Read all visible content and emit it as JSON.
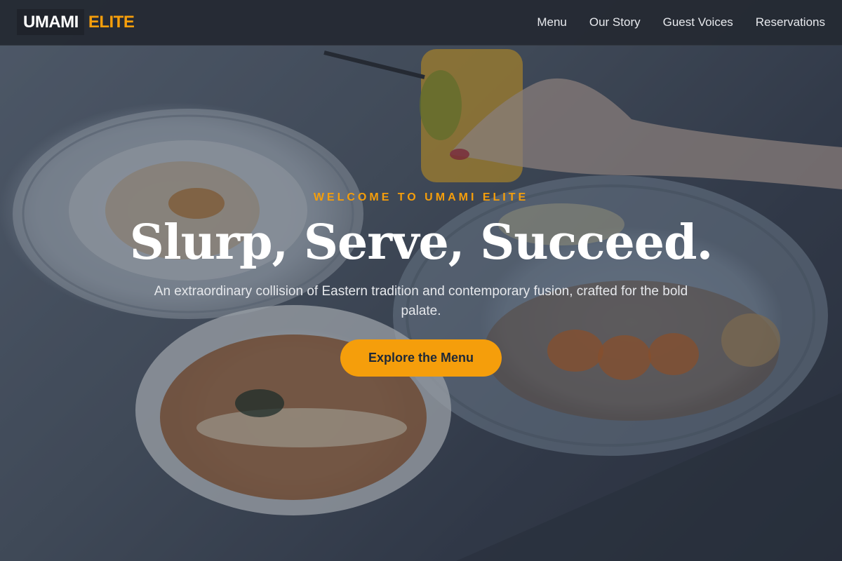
{
  "header": {
    "logo_primary": "UMAMI",
    "logo_accent": "ELITE",
    "nav": [
      {
        "label": "Menu"
      },
      {
        "label": "Our Story"
      },
      {
        "label": "Guest Voices"
      },
      {
        "label": "Reservations"
      }
    ]
  },
  "hero": {
    "eyebrow": "WELCOME TO UMAMI ELITE",
    "headline": "Slurp, Serve, Succeed.",
    "subtitle": "An extraordinary collision of Eastern tradition and contemporary fusion, crafted for the bold palate.",
    "cta_label": "Explore the Menu"
  },
  "colors": {
    "accent": "#f59e0b",
    "header_bg": "#252a34",
    "text_light": "#ffffff"
  }
}
